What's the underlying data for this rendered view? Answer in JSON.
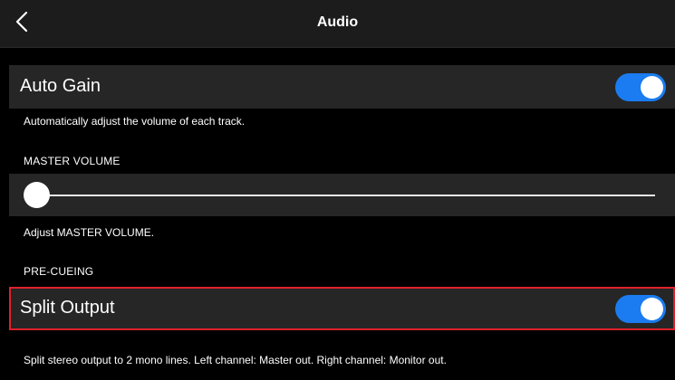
{
  "header": {
    "title": "Audio",
    "back_icon": "chevron-left-icon"
  },
  "auto_gain": {
    "label": "Auto Gain",
    "enabled": true,
    "description": "Automatically adjust the volume of each track."
  },
  "master_volume": {
    "section_label": "MASTER VOLUME",
    "value": 0,
    "description": "Adjust MASTER VOLUME."
  },
  "pre_cueing": {
    "section_label": "PRE-CUEING"
  },
  "split_output": {
    "label": "Split Output",
    "enabled": true,
    "description": "Split stereo output to 2 mono lines. Left channel: Master out. Right channel: Monitor out."
  },
  "colors": {
    "accent": "#1a7cf0",
    "highlight": "#e0202a",
    "row_bg": "#262626",
    "header_bg": "#1c1c1c"
  }
}
